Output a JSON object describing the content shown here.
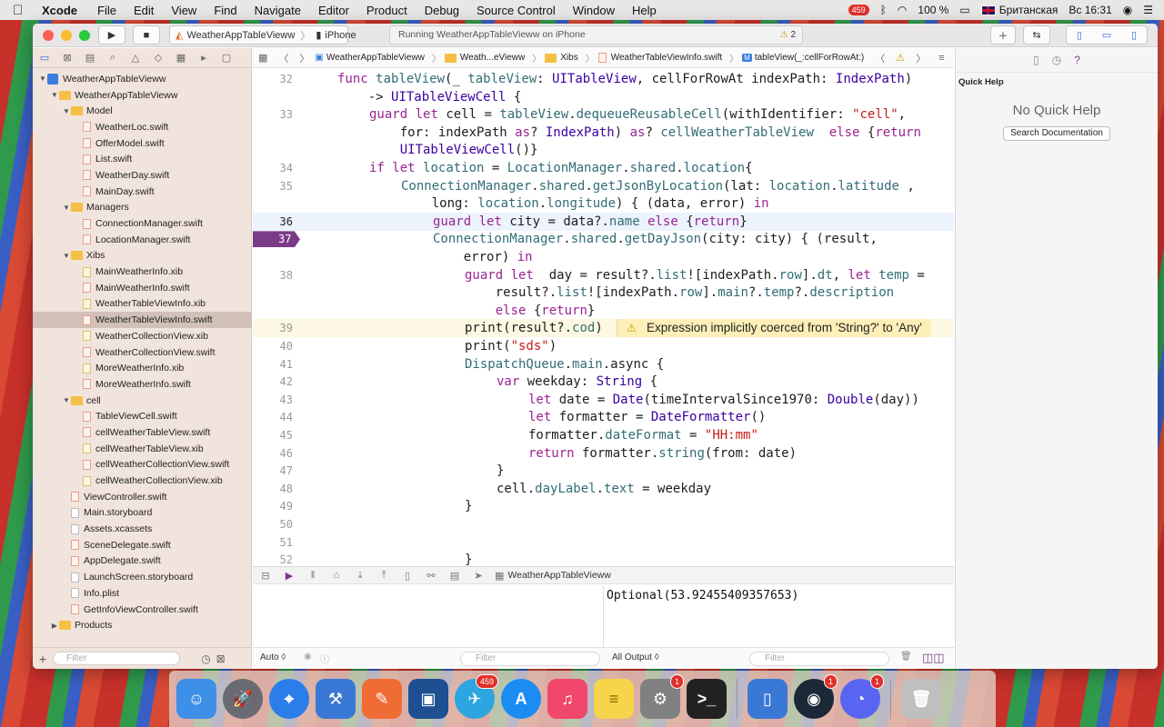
{
  "menubar": {
    "app": "Xcode",
    "items": [
      "File",
      "Edit",
      "View",
      "Find",
      "Navigate",
      "Editor",
      "Product",
      "Debug",
      "Source Control",
      "Window",
      "Help"
    ],
    "status": {
      "badge": "459",
      "battery": "100 %",
      "keyboard": "Британская",
      "clock": "Вс 16:31"
    }
  },
  "toolbar": {
    "scheme": "WeatherAppTableVieww",
    "device": "iPhone",
    "activity": "Running WeatherAppTableVieww on iPhone",
    "warnings": "2"
  },
  "navigator": {
    "filter_placeholder": "Filter",
    "tree": [
      {
        "label": "WeatherAppTableVieww",
        "type": "project",
        "depth": 0,
        "open": true
      },
      {
        "label": "WeatherAppTableVieww",
        "type": "folder",
        "depth": 1,
        "open": true
      },
      {
        "label": "Model",
        "type": "folder",
        "depth": 2,
        "open": true
      },
      {
        "label": "WeatherLoc.swift",
        "type": "swift",
        "depth": 3
      },
      {
        "label": "OfferModel.swift",
        "type": "swift",
        "depth": 3
      },
      {
        "label": "List.swift",
        "type": "swift",
        "depth": 3
      },
      {
        "label": "WeatherDay.swift",
        "type": "swift",
        "depth": 3
      },
      {
        "label": "MainDay.swift",
        "type": "swift",
        "depth": 3
      },
      {
        "label": "Managers",
        "type": "folder",
        "depth": 2,
        "open": true
      },
      {
        "label": "ConnectionManager.swift",
        "type": "swift",
        "depth": 3
      },
      {
        "label": "LocationManager.swift",
        "type": "swift",
        "depth": 3
      },
      {
        "label": "Xibs",
        "type": "folder",
        "depth": 2,
        "open": true
      },
      {
        "label": "MainWeatherInfo.xib",
        "type": "xib",
        "depth": 3
      },
      {
        "label": "MainWeatherInfo.swift",
        "type": "swift",
        "depth": 3
      },
      {
        "label": "WeatherTableViewInfo.xib",
        "type": "xib",
        "depth": 3
      },
      {
        "label": "WeatherTableViewInfo.swift",
        "type": "swift",
        "depth": 3,
        "selected": true
      },
      {
        "label": "WeatherCollectionView.xib",
        "type": "xib",
        "depth": 3
      },
      {
        "label": "WeatherCollectionView.swift",
        "type": "swift",
        "depth": 3
      },
      {
        "label": "MoreWeatherInfo.xib",
        "type": "xib",
        "depth": 3
      },
      {
        "label": "MoreWeatherInfo.swift",
        "type": "swift",
        "depth": 3
      },
      {
        "label": "cell",
        "type": "folder",
        "depth": 2,
        "open": true
      },
      {
        "label": "TableViewCell.swift",
        "type": "swift",
        "depth": 3
      },
      {
        "label": "cellWeatherTableView.swift",
        "type": "swift",
        "depth": 3
      },
      {
        "label": "cellWeatherTableView.xib",
        "type": "xib",
        "depth": 3
      },
      {
        "label": "cellWeatherCollectionView.swift",
        "type": "swift",
        "depth": 3
      },
      {
        "label": "cellWeatherCollectionView.xib",
        "type": "xib",
        "depth": 3
      },
      {
        "label": "ViewController.swift",
        "type": "swift",
        "depth": 2
      },
      {
        "label": "Main.storyboard",
        "type": "file",
        "depth": 2
      },
      {
        "label": "Assets.xcassets",
        "type": "file",
        "depth": 2
      },
      {
        "label": "SceneDelegate.swift",
        "type": "swift",
        "depth": 2
      },
      {
        "label": "AppDelegate.swift",
        "type": "swift",
        "depth": 2
      },
      {
        "label": "LaunchScreen.storyboard",
        "type": "file",
        "depth": 2
      },
      {
        "label": "Info.plist",
        "type": "file",
        "depth": 2
      },
      {
        "label": "GetInfoViewController.swift",
        "type": "swift",
        "depth": 2
      },
      {
        "label": "Products",
        "type": "folder",
        "depth": 1,
        "open": false
      }
    ]
  },
  "jumpbar": {
    "crumbs": [
      "WeatherAppTableVieww",
      "Weath...eVieww",
      "Xibs",
      "WeatherTableViewInfo.swift",
      "tableView(_:cellForRowAt:)"
    ]
  },
  "editor": {
    "lines": [
      {
        "n": "32",
        "t": "func tableView(_ tableView: UITableView, cellForRowAt indexPath: IndexPath)",
        "indent": 0
      },
      {
        "n": "",
        "t": "    -> UITableViewCell {",
        "indent": 0
      },
      {
        "n": "33",
        "t": "guard let cell = tableView.dequeueReusableCell(withIdentifier: \"cell\",",
        "indent": 1
      },
      {
        "n": "",
        "t": "    for: indexPath as? IndexPath) as? cellWeatherTableView  else {return",
        "indent": 1
      },
      {
        "n": "",
        "t": "    UITableViewCell()}",
        "indent": 1
      },
      {
        "n": "34",
        "t": "if let location = LocationManager.shared.location{",
        "indent": 1
      },
      {
        "n": "35",
        "t": "ConnectionManager.shared.getJsonByLocation(lat: location.latitude ,",
        "indent": 2
      },
      {
        "n": "",
        "t": "    long: location.longitude) { (data, error) in",
        "indent": 2
      },
      {
        "n": "36",
        "t": "guard let city = data?.name else {return}",
        "indent": 3,
        "current": true
      },
      {
        "n": "37",
        "t": "ConnectionManager.shared.getDayJson(city: city) { (result,",
        "indent": 3,
        "breakpoint": true
      },
      {
        "n": "",
        "t": "    error) in",
        "indent": 3
      },
      {
        "n": "38",
        "t": "guard let  day = result?.list![indexPath.row].dt, let temp =",
        "indent": 4
      },
      {
        "n": "",
        "t": "    result?.list![indexPath.row].main?.temp?.description",
        "indent": 4
      },
      {
        "n": "",
        "t": "    else {return}",
        "indent": 4
      },
      {
        "n": "39",
        "t": "print(result?.cod)",
        "indent": 4,
        "warning": true
      },
      {
        "n": "40",
        "t": "print(\"sds\")",
        "indent": 4
      },
      {
        "n": "41",
        "t": "DispatchQueue.main.async {",
        "indent": 4
      },
      {
        "n": "42",
        "t": "var weekday: String {",
        "indent": 5
      },
      {
        "n": "43",
        "t": "let date = Date(timeIntervalSince1970: Double(day))",
        "indent": 6
      },
      {
        "n": "44",
        "t": "let formatter = DateFormatter()",
        "indent": 6
      },
      {
        "n": "45",
        "t": "formatter.dateFormat = \"HH:mm\"",
        "indent": 6
      },
      {
        "n": "46",
        "t": "return formatter.string(from: date)",
        "indent": 6
      },
      {
        "n": "47",
        "t": "}",
        "indent": 5
      },
      {
        "n": "48",
        "t": "cell.dayLabel.text = weekday",
        "indent": 5
      },
      {
        "n": "49",
        "t": "}",
        "indent": 4
      },
      {
        "n": "50",
        "t": "",
        "indent": 0
      },
      {
        "n": "51",
        "t": "",
        "indent": 0
      },
      {
        "n": "52",
        "t": "}",
        "indent": 4
      }
    ],
    "warning_message": "Expression implicitly coerced from 'String?' to 'Any'"
  },
  "debug": {
    "target": "WeatherAppTableVieww",
    "console_output": "Optional(53.92455409357653)",
    "auto_label": "Auto ◊",
    "output_label": "All Output ◊",
    "filter_placeholder": "Filter"
  },
  "inspector": {
    "title": "Quick Help",
    "empty": "No Quick Help",
    "search_button": "Search Documentation"
  },
  "dock": {
    "apps": [
      {
        "name": "finder",
        "color": "#3d8fe8",
        "glyph": "☺"
      },
      {
        "name": "launchpad",
        "color": "#6a6a72",
        "glyph": "🚀"
      },
      {
        "name": "safari",
        "color": "#2b7de9",
        "glyph": "⌖"
      },
      {
        "name": "xcode",
        "color": "#3a78d6",
        "glyph": "⚒"
      },
      {
        "name": "postman",
        "color": "#ef6c35",
        "glyph": "✎"
      },
      {
        "name": "sourcetree",
        "color": "#1d4f91",
        "glyph": "▣"
      },
      {
        "name": "telegram",
        "color": "#2ca5e0",
        "glyph": "✈",
        "badge": "459"
      },
      {
        "name": "app-store",
        "color": "#1b8cf2",
        "glyph": "A"
      },
      {
        "name": "music",
        "color": "#f0476a",
        "glyph": "♫"
      },
      {
        "name": "notes",
        "color": "#f6d54a",
        "glyph": "≡"
      },
      {
        "name": "system-preferences",
        "color": "#808080",
        "glyph": "⚙",
        "badge": "1"
      },
      {
        "name": "terminal",
        "color": "#222",
        "glyph": ">_"
      },
      {
        "name": "simulator",
        "color": "#3a78d6",
        "glyph": "▯"
      },
      {
        "name": "steam",
        "color": "#1b2838",
        "glyph": "◉",
        "badge": "1"
      },
      {
        "name": "discord",
        "color": "#5865f2",
        "glyph": "◔",
        "badge": "1"
      },
      {
        "name": "trash",
        "color": "#bfbfbf",
        "glyph": "🗑"
      }
    ]
  }
}
